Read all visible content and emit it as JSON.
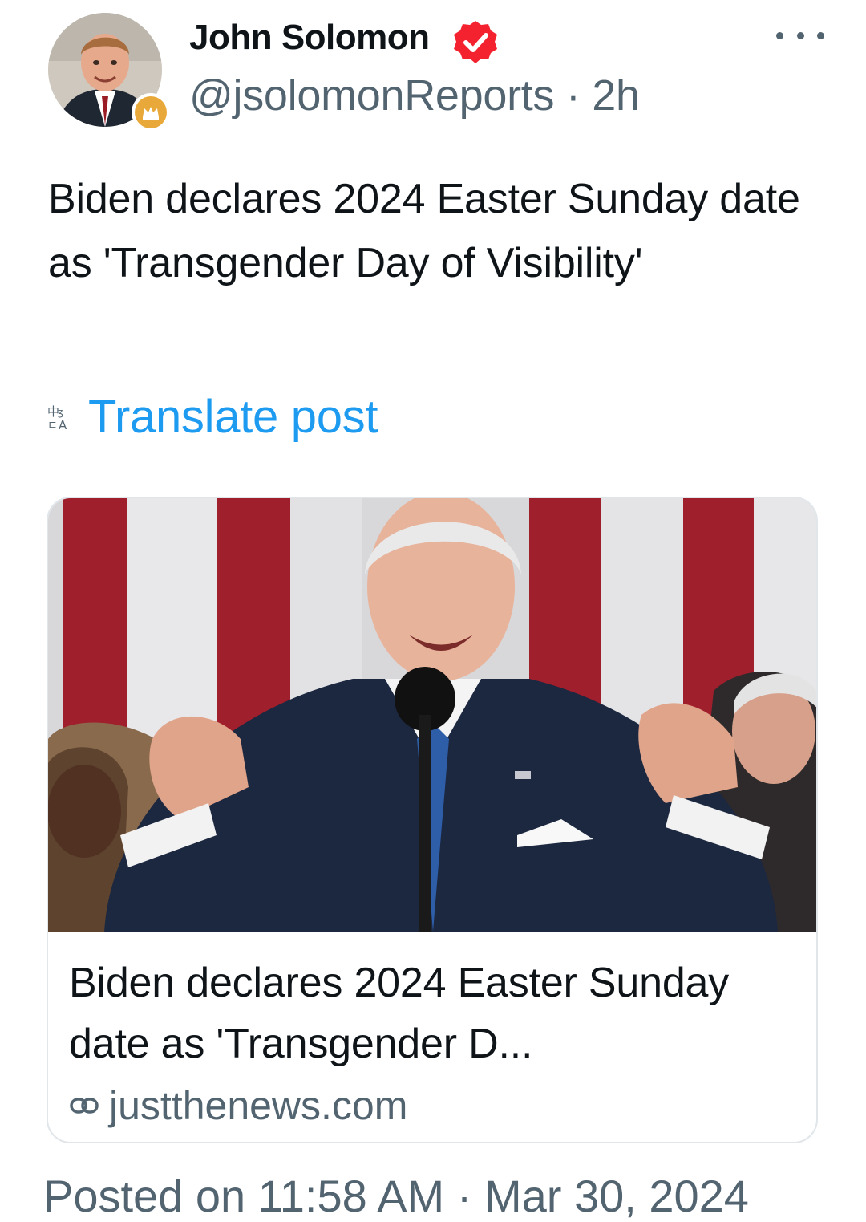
{
  "author": {
    "display_name": "John Solomon",
    "handle": "@jsolomonReports",
    "separator": "·",
    "time_ago": "2h"
  },
  "tweet": {
    "text": "Biden declares 2024 Easter Sunday date as 'Transgender Day of Visibility'"
  },
  "translate": {
    "label": "Translate post",
    "icon": "translate-icon"
  },
  "link_card": {
    "title": "Biden declares 2024 Easter Sunday date as 'Transgender D...",
    "domain": "justthenews.com",
    "link_icon": "link-icon"
  },
  "footer": {
    "posted": "Posted on 11:58 AM · Mar 30, 2024"
  },
  "colors": {
    "accent": "#1d9bf0",
    "verified": "#f4212e",
    "secondary_text": "#536471",
    "crown_badge": "#e8a93a"
  }
}
